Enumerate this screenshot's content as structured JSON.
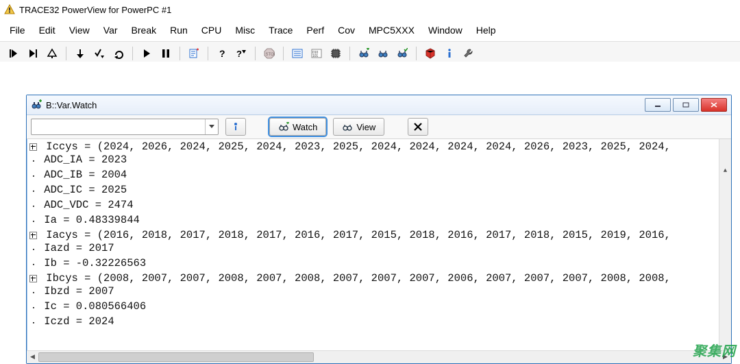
{
  "app": {
    "title": "TRACE32 PowerView for PowerPC #1"
  },
  "menu": {
    "items": [
      "File",
      "Edit",
      "View",
      "Var",
      "Break",
      "Run",
      "CPU",
      "Misc",
      "Trace",
      "Perf",
      "Cov",
      "MPC5XXX",
      "Window",
      "Help"
    ]
  },
  "toolbar_icons": [
    "step-into-start",
    "step-into-end",
    "step-stop",
    "SEP",
    "down-arrow",
    "check-down",
    "redo-arrow",
    "SEP",
    "play",
    "pause",
    "SEP",
    "note-plus",
    "SEP",
    "help-question",
    "help-arrow",
    "SEP",
    "stop-sign",
    "SEP",
    "list-lines",
    "binary-101",
    "chip",
    "SEP",
    "binocular-plus",
    "binocular",
    "binocular-check",
    "SEP",
    "red-cube",
    "info-i",
    "wrench"
  ],
  "subwindow": {
    "title": "B::Var.Watch",
    "watch_label": "Watch",
    "view_label": "View"
  },
  "watch_rows": [
    {
      "g": "plus",
      "text": "Iccys = (2024, 2026, 2024, 2025, 2024, 2023, 2025, 2024, 2024, 2024, 2024, 2026, 2023, 2025, 2024,"
    },
    {
      "g": "dot",
      "text": "ADC_IA = 2023"
    },
    {
      "g": "dot",
      "text": "ADC_IB = 2004"
    },
    {
      "g": "dot",
      "text": "ADC_IC = 2025"
    },
    {
      "g": "dot",
      "text": "ADC_VDC = 2474"
    },
    {
      "g": "dot",
      "text": "Ia = 0.48339844"
    },
    {
      "g": "plus",
      "text": "Iacys = (2016, 2018, 2017, 2018, 2017, 2016, 2017, 2015, 2018, 2016, 2017, 2018, 2015, 2019, 2016,"
    },
    {
      "g": "dot",
      "text": "Iazd = 2017"
    },
    {
      "g": "dot",
      "text": "Ib = -0.32226563"
    },
    {
      "g": "plus",
      "text": "Ibcys = (2008, 2007, 2007, 2008, 2007, 2008, 2007, 2007, 2007, 2006, 2007, 2007, 2007, 2008, 2008,"
    },
    {
      "g": "dot",
      "text": "Ibzd = 2007"
    },
    {
      "g": "dot",
      "text": "Ic = 0.080566406"
    },
    {
      "g": "dot",
      "text": "Iczd = 2024"
    }
  ],
  "watermark": "聚集网"
}
